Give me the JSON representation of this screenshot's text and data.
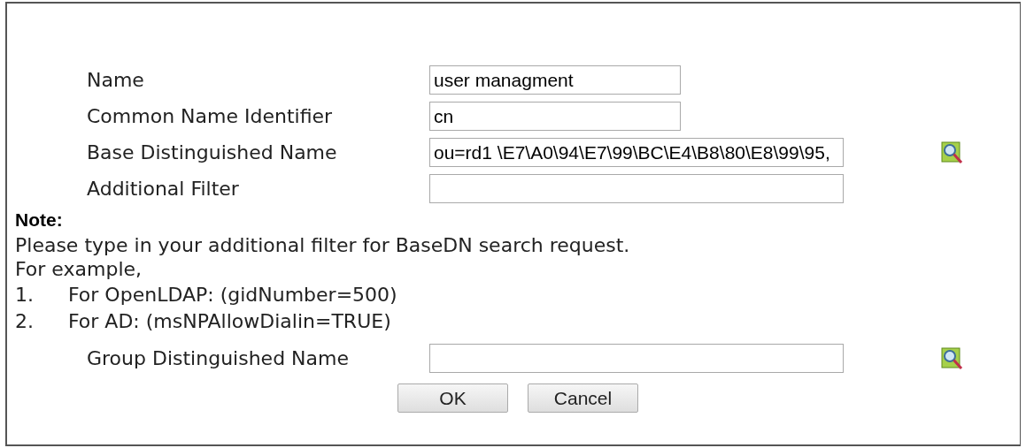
{
  "fields": [
    {
      "label": "Name",
      "value": "user managment",
      "wide": false,
      "lookup": false
    },
    {
      "label": "Common Name Identifier",
      "value": "cn",
      "wide": false,
      "lookup": false
    },
    {
      "label": "Base Distinguished Name",
      "value": "ou=rd1 \\E7\\A0\\94\\E7\\99\\BC\\E4\\B8\\80\\E8\\99\\95,",
      "wide": true,
      "lookup": true
    },
    {
      "label": "Additional Filter",
      "wide": true,
      "lookup": false
    }
  ],
  "note": {
    "title": "Note:",
    "lines": [
      "Please type in your additional filter for BaseDN search request.",
      "For example,"
    ],
    "examples": [
      {
        "number": "1.",
        "text": "For OpenLDAP: (gidNumber=500)"
      },
      {
        "number": "2.",
        "text": "For AD: (msNPAllowDialin=TRUE)"
      }
    ]
  },
  "group_field": {
    "label": "Group Distinguished Name",
    "wide": true,
    "lookup": true
  },
  "buttons": [
    "OK",
    "Cancel"
  ]
}
